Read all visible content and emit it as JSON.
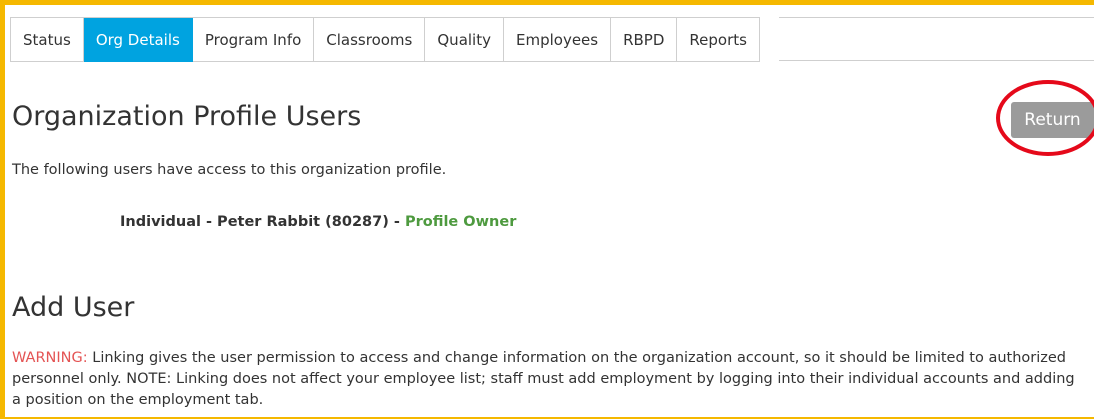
{
  "tabs": [
    {
      "label": "Status",
      "active": false
    },
    {
      "label": "Org Details",
      "active": true
    },
    {
      "label": "Program Info",
      "active": false
    },
    {
      "label": "Classrooms",
      "active": false
    },
    {
      "label": "Quality",
      "active": false
    },
    {
      "label": "Employees",
      "active": false
    },
    {
      "label": "RBPD",
      "active": false
    },
    {
      "label": "Reports",
      "active": false
    }
  ],
  "page": {
    "title": "Organization Profile Users",
    "return_label": "Return",
    "intro": "The following users have access to this organization profile."
  },
  "users": [
    {
      "description": "Individual - Peter Rabbit (80287) - ",
      "role": "Profile Owner"
    }
  ],
  "add_user": {
    "title": "Add User",
    "warning_label": "WARNING:",
    "warning_text": " Linking gives the user permission to access and change information on the organization account, so it should be limited to authorized personnel only. NOTE: Linking does not affect your employee list; staff must add employment by logging into their individual accounts and adding a position on the employment tab."
  },
  "colors": {
    "frame_border": "#f5b800",
    "active_tab": "#00a3e0",
    "return_button": "#9b9b9b",
    "highlight_ring": "#e5091a",
    "owner_text": "#4e9a3f",
    "warning_label": "#e45454"
  }
}
